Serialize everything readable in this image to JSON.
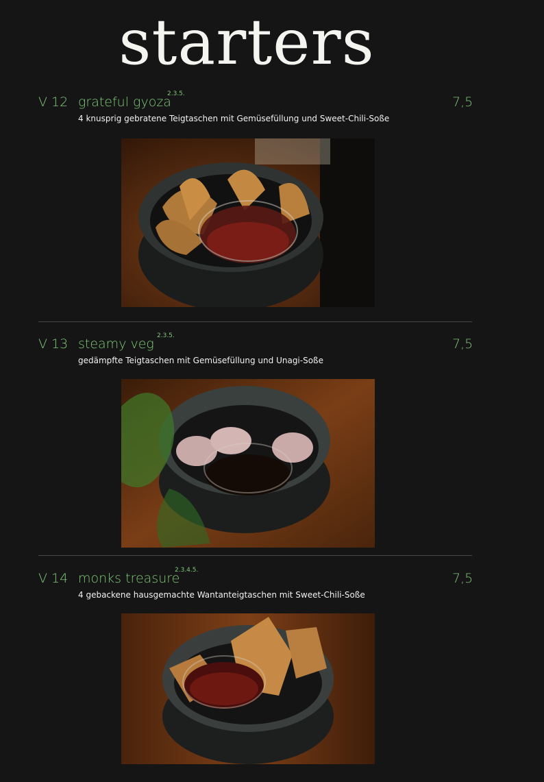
{
  "page": {
    "title": "starters"
  },
  "items": [
    {
      "code": "V 12",
      "name": "grateful gyoza",
      "allergens": "2.3.5.",
      "price": "7,5",
      "description": "4 knusprig gebratene Teigtaschen mit Gemüsefüllung und Sweet-Chili-Soße"
    },
    {
      "code": "V 13",
      "name": "steamy veg",
      "allergens": "2.3.5.",
      "price": "7,5",
      "description": "gedämpfte Teigtaschen mit Gemüsefüllung und Unagi-Soße"
    },
    {
      "code": "V 14",
      "name": "monks treasure",
      "allergens": "2.3.4.5.",
      "price": "7,5",
      "description": "4 gebackene hausgemachte Wantanteigtaschen mit Sweet-Chili-Soße"
    }
  ],
  "colors": {
    "background": "#151515",
    "accent_green": "#7fca78",
    "text": "#f2f2f2"
  }
}
